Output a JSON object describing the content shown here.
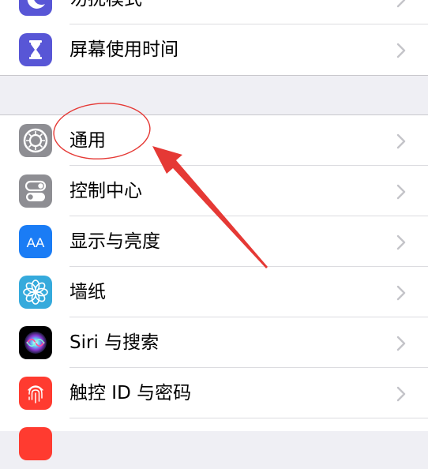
{
  "colors": {
    "accent_annotation": "#e53935",
    "focus_icon": "#5856d6",
    "screen_time_icon": "#5856d6",
    "general_icon": "#8e8e93",
    "control_center_icon": "#8e8e93",
    "display_icon": "#1a7cf5",
    "wallpaper_icon": "#35aadc",
    "touch_id_icon": "#ff3b30"
  },
  "rows_top": [
    {
      "label": "勿扰模式",
      "icon": "moon-icon"
    },
    {
      "label": "屏幕使用时间",
      "icon": "hourglass-icon"
    }
  ],
  "rows_main": [
    {
      "label": "通用",
      "icon": "gear-icon"
    },
    {
      "label": "控制中心",
      "icon": "toggles-icon"
    },
    {
      "label": "显示与亮度",
      "icon": "text-size-icon",
      "icon_text": "AA"
    },
    {
      "label": "墙纸",
      "icon": "flower-icon"
    },
    {
      "label": "Siri 与搜索",
      "icon": "siri-icon"
    },
    {
      "label": "触控 ID 与密码",
      "icon": "fingerprint-icon"
    }
  ],
  "annotation": {
    "type": "ellipse-and-arrow",
    "target": "通用"
  }
}
